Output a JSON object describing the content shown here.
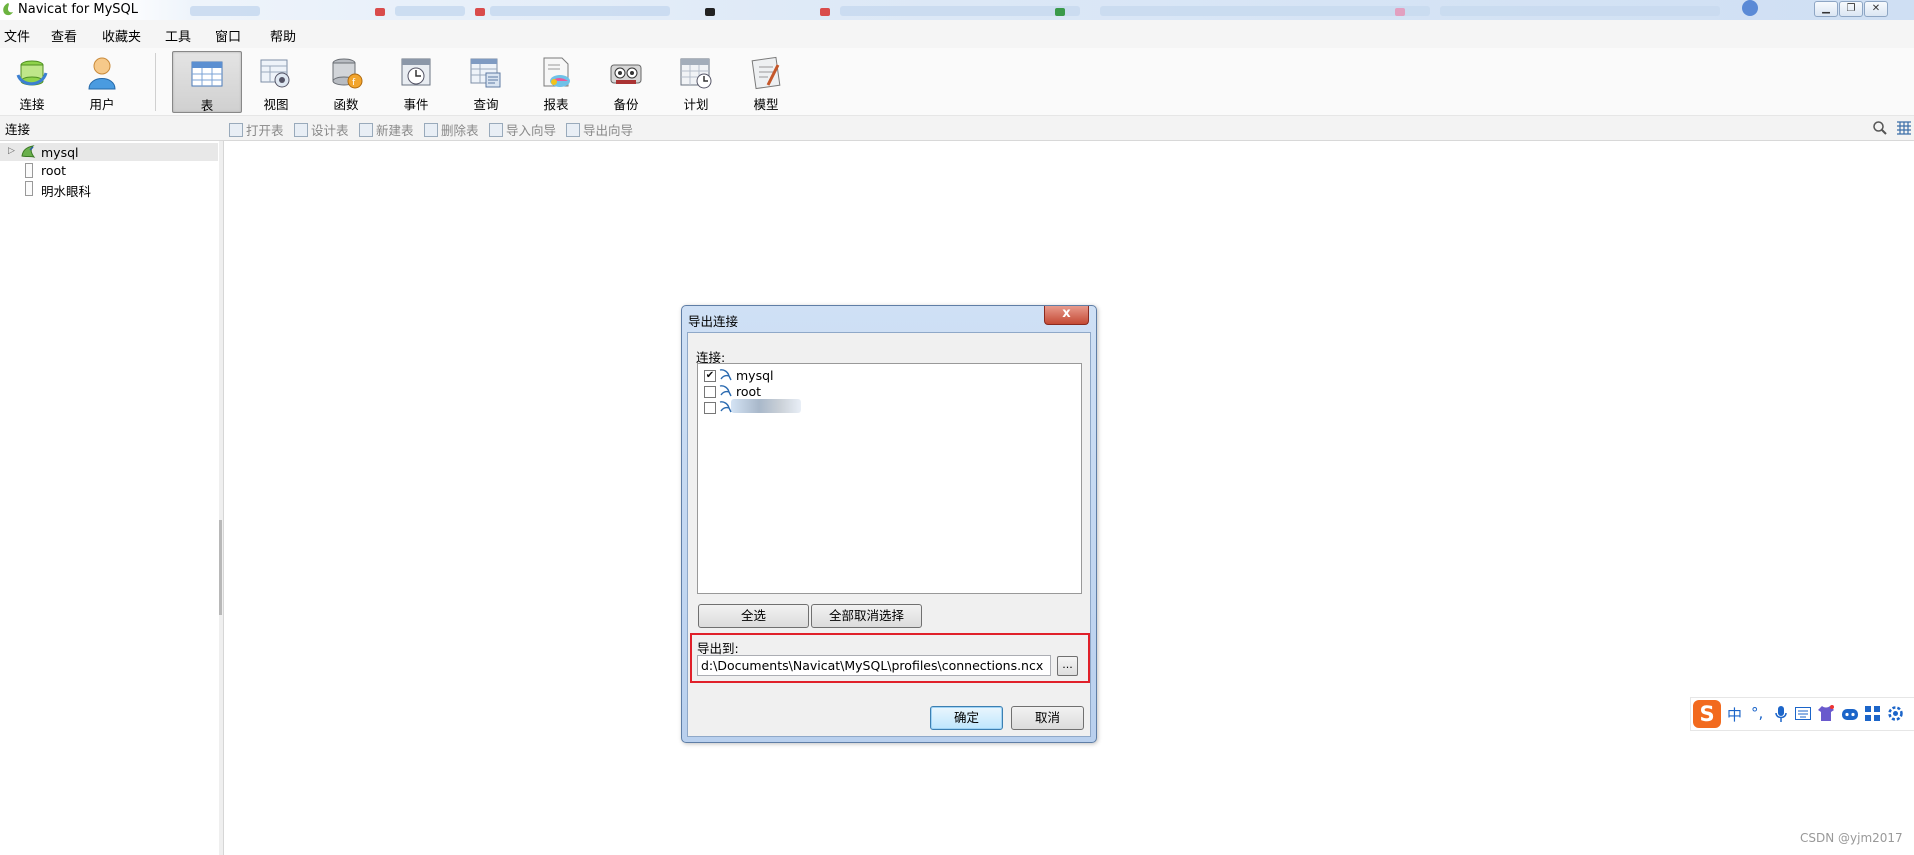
{
  "window": {
    "title": "Navicat for MySQL",
    "controls": [
      "minimize-icon",
      "restore-icon",
      "close-icon"
    ]
  },
  "menu": [
    "文件",
    "查看",
    "收藏夹",
    "工具",
    "窗口",
    "帮助"
  ],
  "toolbar": {
    "buttons": [
      {
        "label": "连接",
        "icon": "connection-icon"
      },
      {
        "label": "用户",
        "icon": "user-icon"
      },
      {
        "label": "表",
        "icon": "table-icon",
        "active": true
      },
      {
        "label": "视图",
        "icon": "view-icon"
      },
      {
        "label": "函数",
        "icon": "function-icon"
      },
      {
        "label": "事件",
        "icon": "event-icon"
      },
      {
        "label": "查询",
        "icon": "query-icon"
      },
      {
        "label": "报表",
        "icon": "report-icon"
      },
      {
        "label": "备份",
        "icon": "backup-icon"
      },
      {
        "label": "计划",
        "icon": "schedule-icon"
      },
      {
        "label": "模型",
        "icon": "model-icon"
      }
    ]
  },
  "subtoolbar": {
    "header": "连接",
    "actions": [
      "打开表",
      "设计表",
      "新建表",
      "删除表",
      "导入向导",
      "导出向导"
    ]
  },
  "tree": {
    "items": [
      {
        "label": "mysql",
        "selected": true
      },
      {
        "label": "root"
      },
      {
        "label": "明水眼科"
      }
    ]
  },
  "dialog": {
    "title": "导出连接",
    "close": "x",
    "connections_label": "连接:",
    "connections": [
      {
        "name": "mysql",
        "checked": true
      },
      {
        "name": "root",
        "checked": false
      },
      {
        "name": "",
        "checked": false
      }
    ],
    "select_all": "全选",
    "deselect_all": "全部取消选择",
    "export_to_label": "导出到:",
    "export_path": "d:\\Documents\\Navicat\\MySQL\\profiles\\connections.ncx",
    "browse": "...",
    "ok": "确定",
    "cancel": "取消"
  },
  "ime": {
    "logo": "S",
    "items": [
      "中",
      "°,",
      "mic-icon",
      "keyboard-icon",
      "shirt-icon",
      "robot-icon",
      "grid-icon",
      "settings-icon"
    ]
  },
  "watermark": "CSDN @yjm2017"
}
